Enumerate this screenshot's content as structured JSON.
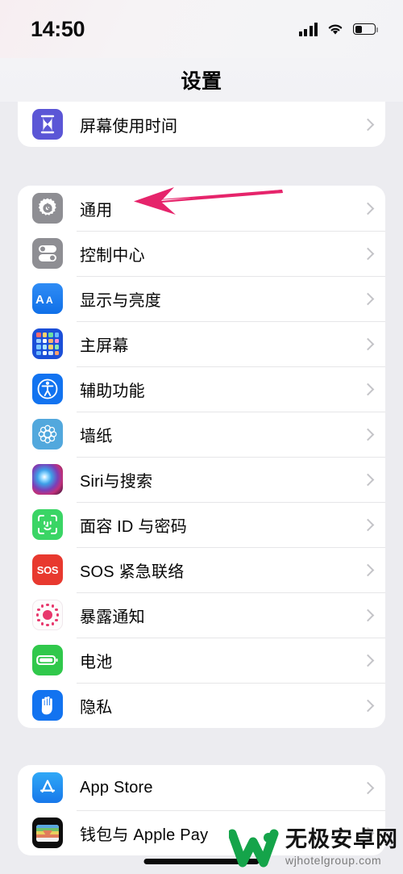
{
  "status_bar": {
    "time": "14:50",
    "signal_icon": "cellular-bars-icon",
    "wifi_icon": "wifi-icon",
    "battery_icon": "battery-icon",
    "battery_level": 33
  },
  "nav": {
    "title": "设置"
  },
  "groups": [
    {
      "name": "screen-time-group",
      "rows": [
        {
          "label": "屏幕使用时间",
          "icon": "hourglass-icon",
          "icon_class": "ic-screentime",
          "color": "#5b56d6"
        }
      ]
    },
    {
      "name": "system-group",
      "rows": [
        {
          "label": "通用",
          "icon": "gear-icon",
          "icon_class": "ic-general",
          "color": "#8e8e93"
        },
        {
          "label": "控制中心",
          "icon": "toggles-icon",
          "icon_class": "ic-control",
          "color": "#8e8e93"
        },
        {
          "label": "显示与亮度",
          "icon": "aa-text-icon",
          "icon_class": "ic-display",
          "color": "#1878ea"
        },
        {
          "label": "主屏幕",
          "icon": "app-grid-icon",
          "icon_class": "ic-home",
          "color": "#1b4fd8"
        },
        {
          "label": "辅助功能",
          "icon": "accessibility-icon",
          "icon_class": "ic-access",
          "color": "#1273f0"
        },
        {
          "label": "墙纸",
          "icon": "flower-icon",
          "icon_class": "ic-wallpaper",
          "color": "#52a8dd"
        },
        {
          "label": "Siri与搜索",
          "icon": "siri-orb-icon",
          "icon_class": "ic-siri",
          "color": "#7a3fb8"
        },
        {
          "label": "面容 ID 与密码",
          "icon": "face-id-icon",
          "icon_class": "ic-faceid",
          "color": "#3ad565"
        },
        {
          "label": "SOS 紧急联络",
          "icon": "sos-icon",
          "icon_class": "ic-sos",
          "color": "#e8392f"
        },
        {
          "label": "暴露通知",
          "icon": "exposure-dots-icon",
          "icon_class": "ic-exposure",
          "color": "#e8386d"
        },
        {
          "label": "电池",
          "icon": "battery-icon",
          "icon_class": "ic-battery",
          "color": "#30c84b"
        },
        {
          "label": "隐私",
          "icon": "hand-icon",
          "icon_class": "ic-privacy",
          "color": "#1273f0"
        }
      ]
    },
    {
      "name": "store-group",
      "rows": [
        {
          "label": "App Store",
          "icon": "app-store-icon",
          "icon_class": "ic-appstore",
          "color": "#1878ea"
        },
        {
          "label": "钱包与 Apple Pay",
          "icon": "wallet-icon",
          "icon_class": "ic-wallet",
          "color": "#0d0d0d"
        }
      ]
    }
  ],
  "annotation": {
    "name": "pink-arrow-pointing-to-general",
    "color": "#e6246b",
    "direction": "left",
    "points_to": "通用"
  },
  "watermark": {
    "site_name": "无极安卓网",
    "url": "wjhotelgroup.com",
    "logo_color": "#15a44a"
  },
  "home_indicator": {
    "name": "home-indicator"
  }
}
